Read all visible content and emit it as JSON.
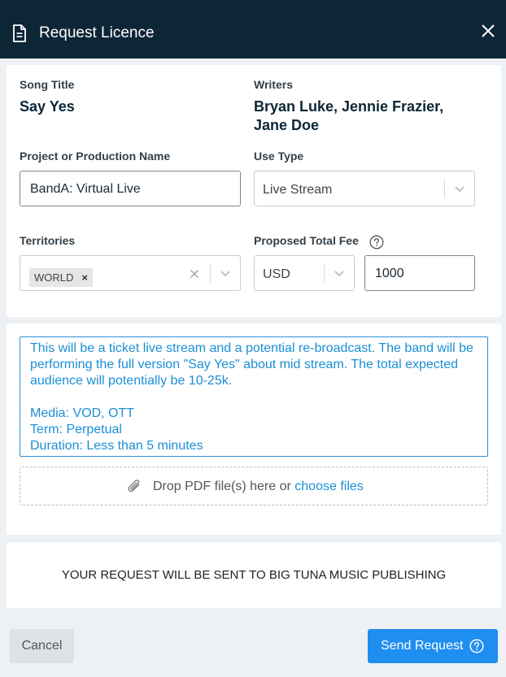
{
  "header": {
    "title": "Request Licence",
    "icon": "document-icon",
    "close_icon": "close-icon"
  },
  "song": {
    "title_label": "Song Title",
    "title_value": "Say Yes"
  },
  "writers": {
    "label": "Writers",
    "value": "Bryan Luke, Jennie Frazier, Jane Doe"
  },
  "project": {
    "label": "Project or Production Name",
    "value": "BandA: Virtual Live"
  },
  "use_type": {
    "label": "Use Type",
    "selected": "Live Stream"
  },
  "territories": {
    "label": "Territories",
    "tags": [
      "WORLD"
    ],
    "tag_remove": "×"
  },
  "fee": {
    "label": "Proposed Total Fee",
    "currency": "USD",
    "amount": "1000"
  },
  "notes": {
    "text": "This will be a ticket live stream and a potential re-broadcast. The band will be performing the full version \"Say Yes\" about mid stream. The total expected audience will potentially be 10-25k.\n\nMedia: VOD, OTT\nTerm: Perpetual\nDuration: Less than 5 minutes"
  },
  "dropzone": {
    "text": "Drop PDF file(s) here or",
    "link": "choose files"
  },
  "notice": "YOUR REQUEST WILL BE SENT TO BIG TUNA MUSIC PUBLISHING",
  "footer": {
    "cancel_label": "Cancel",
    "send_label": "Send Request"
  },
  "colors": {
    "header_bg": "#0d2636",
    "accent": "#1f8ef1",
    "link": "#1b8fd6"
  }
}
